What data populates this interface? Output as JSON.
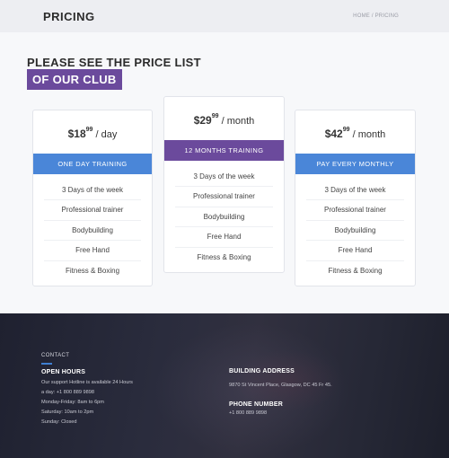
{
  "header": {
    "page_title": "PRICING",
    "breadcrumb_home": "HOME",
    "breadcrumb_sep": " / ",
    "breadcrumb_current": "PRICING"
  },
  "intro": {
    "headline_line1": "PLEASE SEE THE PRICE LIST",
    "headline_line2": "OF OUR CLUB"
  },
  "plans": [
    {
      "price_whole": "$18",
      "price_cents": "99",
      "period": "/ day",
      "band_label": "ONE DAY TRAINING",
      "band_color": "#4a86d8",
      "features": [
        "3 Days of the week",
        "Professional trainer",
        "Bodybuilding",
        "Free Hand",
        "Fitness & Boxing"
      ]
    },
    {
      "price_whole": "$29",
      "price_cents": "99",
      "period": "/ month",
      "band_label": "12 MONTHS TRAINING",
      "band_color": "#6b4a9c",
      "features": [
        "3 Days of the week",
        "Professional trainer",
        "Bodybuilding",
        "Free Hand",
        "Fitness & Boxing"
      ]
    },
    {
      "price_whole": "$42",
      "price_cents": "99",
      "period": "/ month",
      "band_label": "PAY EVERY MONTHLY",
      "band_color": "#4a86d8",
      "features": [
        "3 Days of the week",
        "Professional trainer",
        "Bodybuilding",
        "Free Hand",
        "Fitness & Boxing"
      ]
    }
  ],
  "footer": {
    "contact_label": "CONTACT",
    "hours_title": "OPEN HOURS",
    "hours_lines": [
      "Our support Hotline is available 24 Hours",
      "a day: +1 800 889 9898",
      "Monday-Friday: 8am to 6pm",
      "Saturday: 10am to 2pm",
      "Sunday: Closed"
    ],
    "address_title": "BUILDING ADDRESS",
    "address_text": "9870 St Vincent Place, Glasgow, DC 45 Fr 45.",
    "phone_title": "PHONE NUMBER",
    "phone_text": "+1 800 889 9898"
  }
}
